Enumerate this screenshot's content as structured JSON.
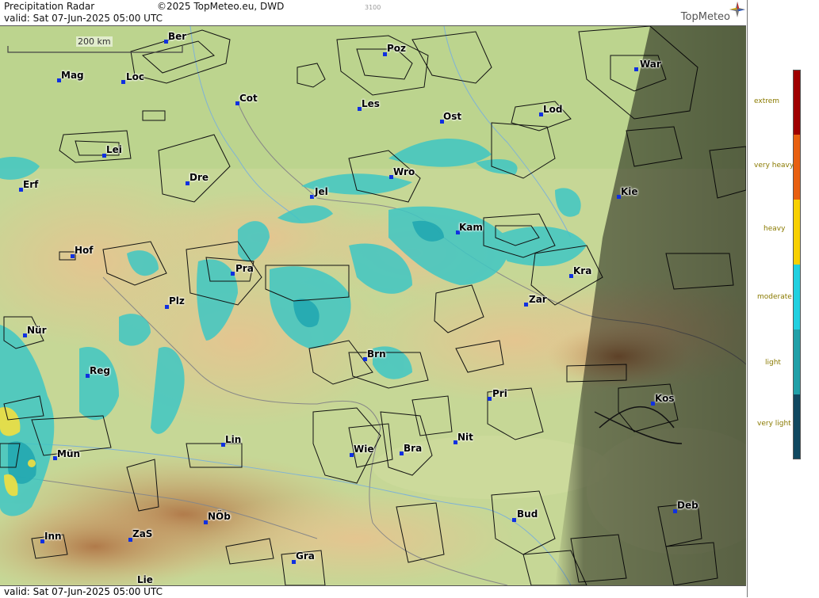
{
  "header": {
    "title": "Precipitation Radar",
    "copyright": "©2025 TopMeteo.eu, DWD",
    "valid": "valid:  Sat  07-Jun-2025 05:00 UTC",
    "small_code": "3100",
    "logo": "TopMeteo"
  },
  "footer": {
    "valid": "valid:  Sat  07-Jun-2025 05:00 UTC"
  },
  "scale": {
    "label": "200 km"
  },
  "cities": [
    {
      "name": "Ber"
    },
    {
      "name": "Poz"
    },
    {
      "name": "War"
    },
    {
      "name": "Mag"
    },
    {
      "name": "Loc"
    },
    {
      "name": "Cot"
    },
    {
      "name": "Les"
    },
    {
      "name": "Lod"
    },
    {
      "name": "Ost"
    },
    {
      "name": "Lei"
    },
    {
      "name": "Dre"
    },
    {
      "name": "Wro"
    },
    {
      "name": "Erf"
    },
    {
      "name": "Jel"
    },
    {
      "name": "Kie"
    },
    {
      "name": "Kam"
    },
    {
      "name": "Hof"
    },
    {
      "name": "Pra"
    },
    {
      "name": "Kra"
    },
    {
      "name": "Plz"
    },
    {
      "name": "Zar"
    },
    {
      "name": "Nür"
    },
    {
      "name": "Brn"
    },
    {
      "name": "Reg"
    },
    {
      "name": "Pri"
    },
    {
      "name": "Kos"
    },
    {
      "name": "Lin"
    },
    {
      "name": "Nit"
    },
    {
      "name": "Wie"
    },
    {
      "name": "Bra"
    },
    {
      "name": "Mün"
    },
    {
      "name": "Bud"
    },
    {
      "name": "Deb"
    },
    {
      "name": "NÖb"
    },
    {
      "name": "Inn"
    },
    {
      "name": "ZaS"
    },
    {
      "name": "Gra"
    },
    {
      "name": "Lie"
    }
  ],
  "legend": [
    {
      "label": "extrem",
      "color": "#a00000"
    },
    {
      "label": "very heavy",
      "color": "#e86010"
    },
    {
      "label": "heavy",
      "color": "#f8d000"
    },
    {
      "label": "moderate",
      "color": "#20d0e0"
    },
    {
      "label": "light",
      "color": "#20a0a8"
    },
    {
      "label": "very light",
      "color": "#104860"
    }
  ],
  "night_shading": true
}
